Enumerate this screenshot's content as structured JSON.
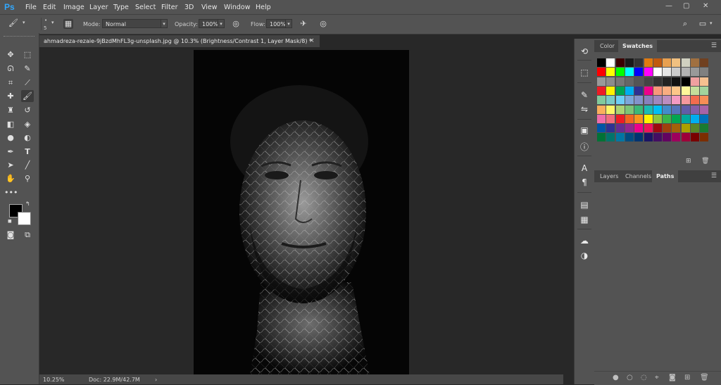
{
  "app": {
    "logo": "Ps"
  },
  "menu": [
    "File",
    "Edit",
    "Image",
    "Layer",
    "Type",
    "Select",
    "Filter",
    "3D",
    "View",
    "Window",
    "Help"
  ],
  "window_controls": {
    "minimize": "—",
    "restore": "▢",
    "close": "✕"
  },
  "options": {
    "brush_size": "5",
    "mode_label": "Mode:",
    "mode_value": "Normal",
    "opacity_label": "Opacity:",
    "opacity_value": "100%",
    "flow_label": "Flow:",
    "flow_value": "100%"
  },
  "document": {
    "tab_title": "ahmadreza-rezaie-9jBzdMhFL3g-unsplash.jpg @ 10.3% (Brightness/Contrast 1, Layer Mask/8) *",
    "close": "×"
  },
  "status": {
    "zoom": "10.25%",
    "doc": "Doc: 22.9M/42.7M",
    "arrow": "›"
  },
  "panels": {
    "color_tab": "Color",
    "swatches_tab": "Swatches",
    "layers_tab": "Layers",
    "channels_tab": "Channels",
    "paths_tab": "Paths"
  },
  "colors": {
    "accent": "#31a8ff",
    "panel": "#535353",
    "workspace": "#282828"
  },
  "icons": {
    "tools": [
      "move-icon",
      "marquee-icon",
      "lasso-icon",
      "quick-select-icon",
      "crop-icon",
      "eyedropper-icon",
      "healing-icon",
      "brush-icon",
      "stamp-icon",
      "history-brush-icon",
      "eraser-icon",
      "paint-bucket-icon",
      "blur-icon",
      "dodge-icon",
      "pen-icon",
      "type-icon",
      "path-select-icon",
      "line-icon",
      "hand-icon",
      "zoom-icon",
      "more-icon"
    ]
  },
  "swatches": [
    [
      "#000000",
      "#ffffff",
      "#3a0000",
      "#1a1a1a",
      "#333333",
      "#e07a10",
      "#c05a10",
      "#e8a050",
      "#f0c080",
      "#d0d0c0",
      "#a07040",
      "#704020"
    ],
    [
      "#ff0000",
      "#ffff00",
      "#00ff00",
      "#00ffff",
      "#0000ff",
      "#ff00ff",
      "#ffffff",
      "#e6e6e6",
      "#cccccc",
      "#b3b3b3",
      "#999999",
      "#808080"
    ],
    [
      "#999999",
      "#8c8c8c",
      "#777777",
      "#666666",
      "#555555",
      "#444444",
      "#333333",
      "#222222",
      "#111111",
      "#000000",
      "#f0a0a0",
      "#f5c090"
    ],
    [
      "#ed1c24",
      "#fff200",
      "#00a651",
      "#00aeef",
      "#2e3192",
      "#ec008c",
      "#f7977a",
      "#f9ad81",
      "#fdc689",
      "#fff79a",
      "#c4df9b",
      "#a2d39c"
    ],
    [
      "#82ca9c",
      "#7accc8",
      "#6dcff6",
      "#7da7d9",
      "#8393ca",
      "#8781bd",
      "#a187be",
      "#bc8dbf",
      "#f49ac2",
      "#f6989d",
      "#f26c4f",
      "#f68e56"
    ],
    [
      "#fbaf5d",
      "#fff568",
      "#acd373",
      "#7cc576",
      "#3bb878",
      "#1abbb4",
      "#00bff3",
      "#438ccb",
      "#5574b9",
      "#605ca8",
      "#855fa8",
      "#a763a8"
    ],
    [
      "#f06eaa",
      "#f26d7d",
      "#ed1c24",
      "#f26522",
      "#f7941d",
      "#fff200",
      "#8dc63f",
      "#39b54a",
      "#00a651",
      "#00a99d",
      "#00aeef",
      "#0072bc"
    ],
    [
      "#0054a6",
      "#2e3192",
      "#662d91",
      "#92278f",
      "#ec008c",
      "#ed145b",
      "#9e0b0f",
      "#a0410d",
      "#a36209",
      "#aba000",
      "#598527",
      "#197b30"
    ],
    [
      "#007236",
      "#00746b",
      "#0076a3",
      "#004b80",
      "#003471",
      "#1b1464",
      "#440e62",
      "#630460",
      "#9e005d",
      "#9e0039",
      "#790000",
      "#7b2e00"
    ]
  ]
}
